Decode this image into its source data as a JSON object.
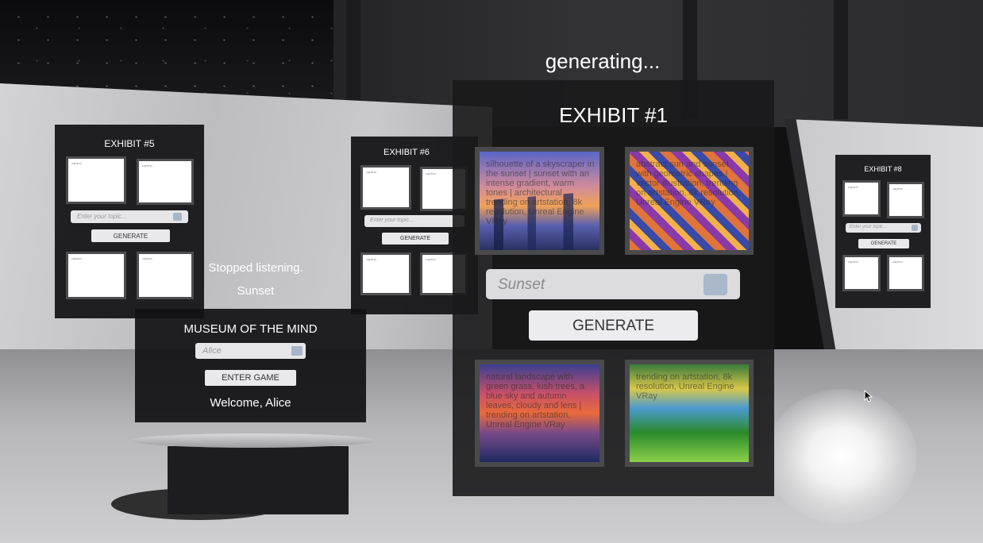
{
  "status_text": "generating...",
  "voice": {
    "status": "Stopped listening.",
    "heard": "Sunset"
  },
  "exhibit1": {
    "title": "EXHIBIT #1",
    "input_placeholder": "Sunset",
    "generate_label": "GENERATE",
    "captions": [
      "silhouette of a skyscraper in the sunset | sunset with an intense gradient, warm tones | architectural trending on artstation, 8k resolution, Unreal Engine VRay",
      "abstract sun and sunset with geometric shapes | vector illustration, trending on artstation, 8k resolution, Unreal Engine VRay",
      "natural landscape with green grass, lush trees, a blue sky and autumn leaves, cloudy and lens | trending on artstation, Unreal Engine VRay",
      "trending on artstation, 8k resolution, Unreal Engine VRay"
    ]
  },
  "exhibit5": {
    "title": "EXHIBIT #5",
    "input_placeholder": "Enter your topic...",
    "generate_label": "GENERATE",
    "caption": "caption"
  },
  "exhibit6": {
    "title": "EXHIBIT #6",
    "input_placeholder": "Enter your topic...",
    "generate_label": "GENERATE",
    "caption": "caption"
  },
  "exhibit8": {
    "title": "EXHIBIT #8",
    "input_placeholder": "Enter your topic...",
    "generate_label": "GENERATE",
    "caption": "caption"
  },
  "login": {
    "title": "MUSEUM OF THE MIND",
    "name_value": "Alice",
    "enter_label": "ENTER GAME",
    "welcome": "Welcome, Alice"
  },
  "icons": [
    "microphone-icon",
    "mouse-cursor-icon"
  ],
  "colors": {
    "panel": "#121214",
    "button": "#e9e9eb",
    "input": "#e6e6e8",
    "frame": "#4a4a4d"
  }
}
